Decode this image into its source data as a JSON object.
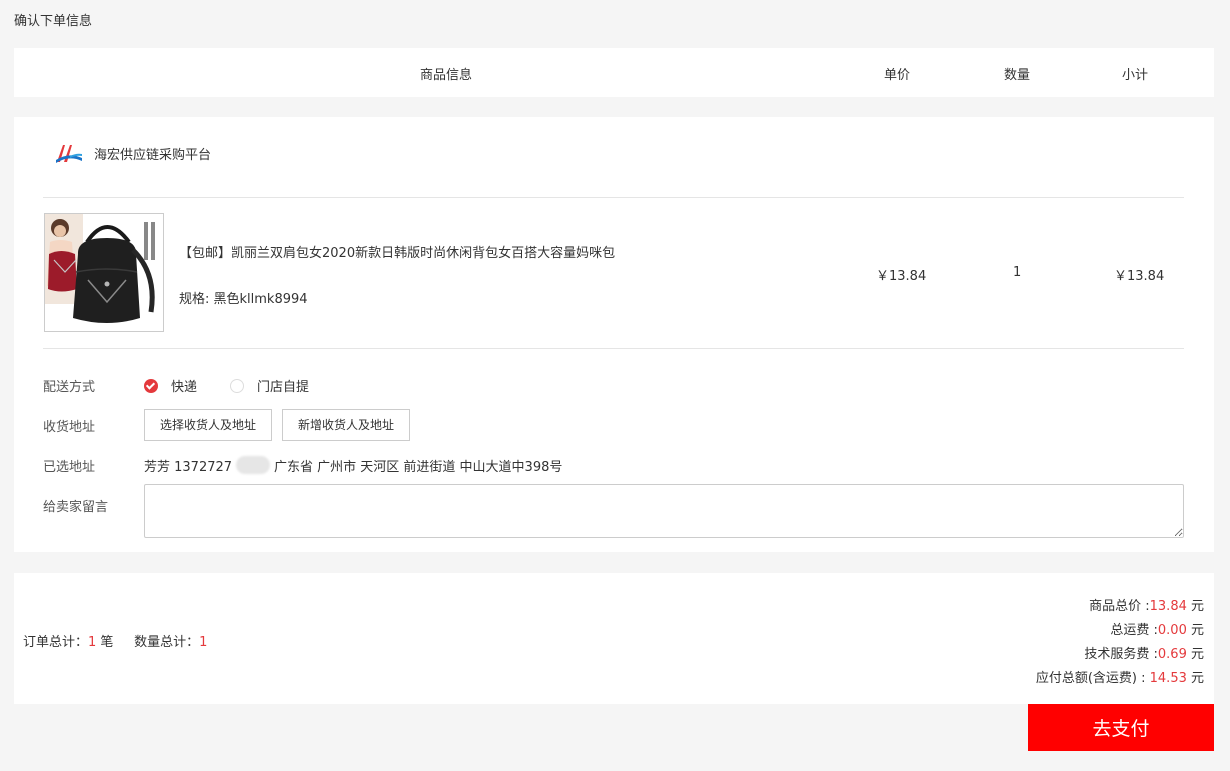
{
  "page": {
    "heading": "确认下单信息"
  },
  "table_header": {
    "product_info": "商品信息",
    "unit_price": "单价",
    "quantity": "数量",
    "subtotal": "小计"
  },
  "store": {
    "name": "海宏供应链采购平台",
    "logo_icon": "hh-logo-icon"
  },
  "product": {
    "title": "【包邮】凯丽兰双肩包女2020新款日韩版时尚休闲背包女百搭大容量妈咪包",
    "spec": "规格: 黑色kllmk8994",
    "unit_price": "￥13.84",
    "quantity": "1",
    "subtotal": "￥13.84"
  },
  "form": {
    "shipping_label": "配送方式",
    "shipping_options": [
      {
        "label": "快递",
        "selected": true
      },
      {
        "label": "门店自提",
        "selected": false
      }
    ],
    "address_label": "收货地址",
    "select_address_button": "选择收货人及地址",
    "new_address_button": "新增收货人及地址",
    "selected_address_label": "已选地址",
    "selected_name_phone": "芳芳 1372727",
    "selected_address": "广东省 广州市 天河区 前进街道 中山大道中398号",
    "message_label": "给卖家留言",
    "message_value": ""
  },
  "summary": {
    "order_total_label": "订单总计：",
    "order_total_value": "1",
    "order_total_unit": " 笔",
    "qty_total_label": "数量总计：",
    "qty_total_value": "1",
    "goods_total_label": "商品总价 :",
    "goods_total_value": "13.84",
    "freight_label": "总运费 :",
    "freight_value": "0.00",
    "service_fee_label": "技术服务费 :",
    "service_fee_value": "0.69",
    "payable_label": "应付总额(含运费) : ",
    "payable_value": "14.53",
    "currency_unit": " 元"
  },
  "pay_button": "去支付",
  "colors": {
    "accent": "#e4393c",
    "pay_button_bg": "#ff0000"
  }
}
